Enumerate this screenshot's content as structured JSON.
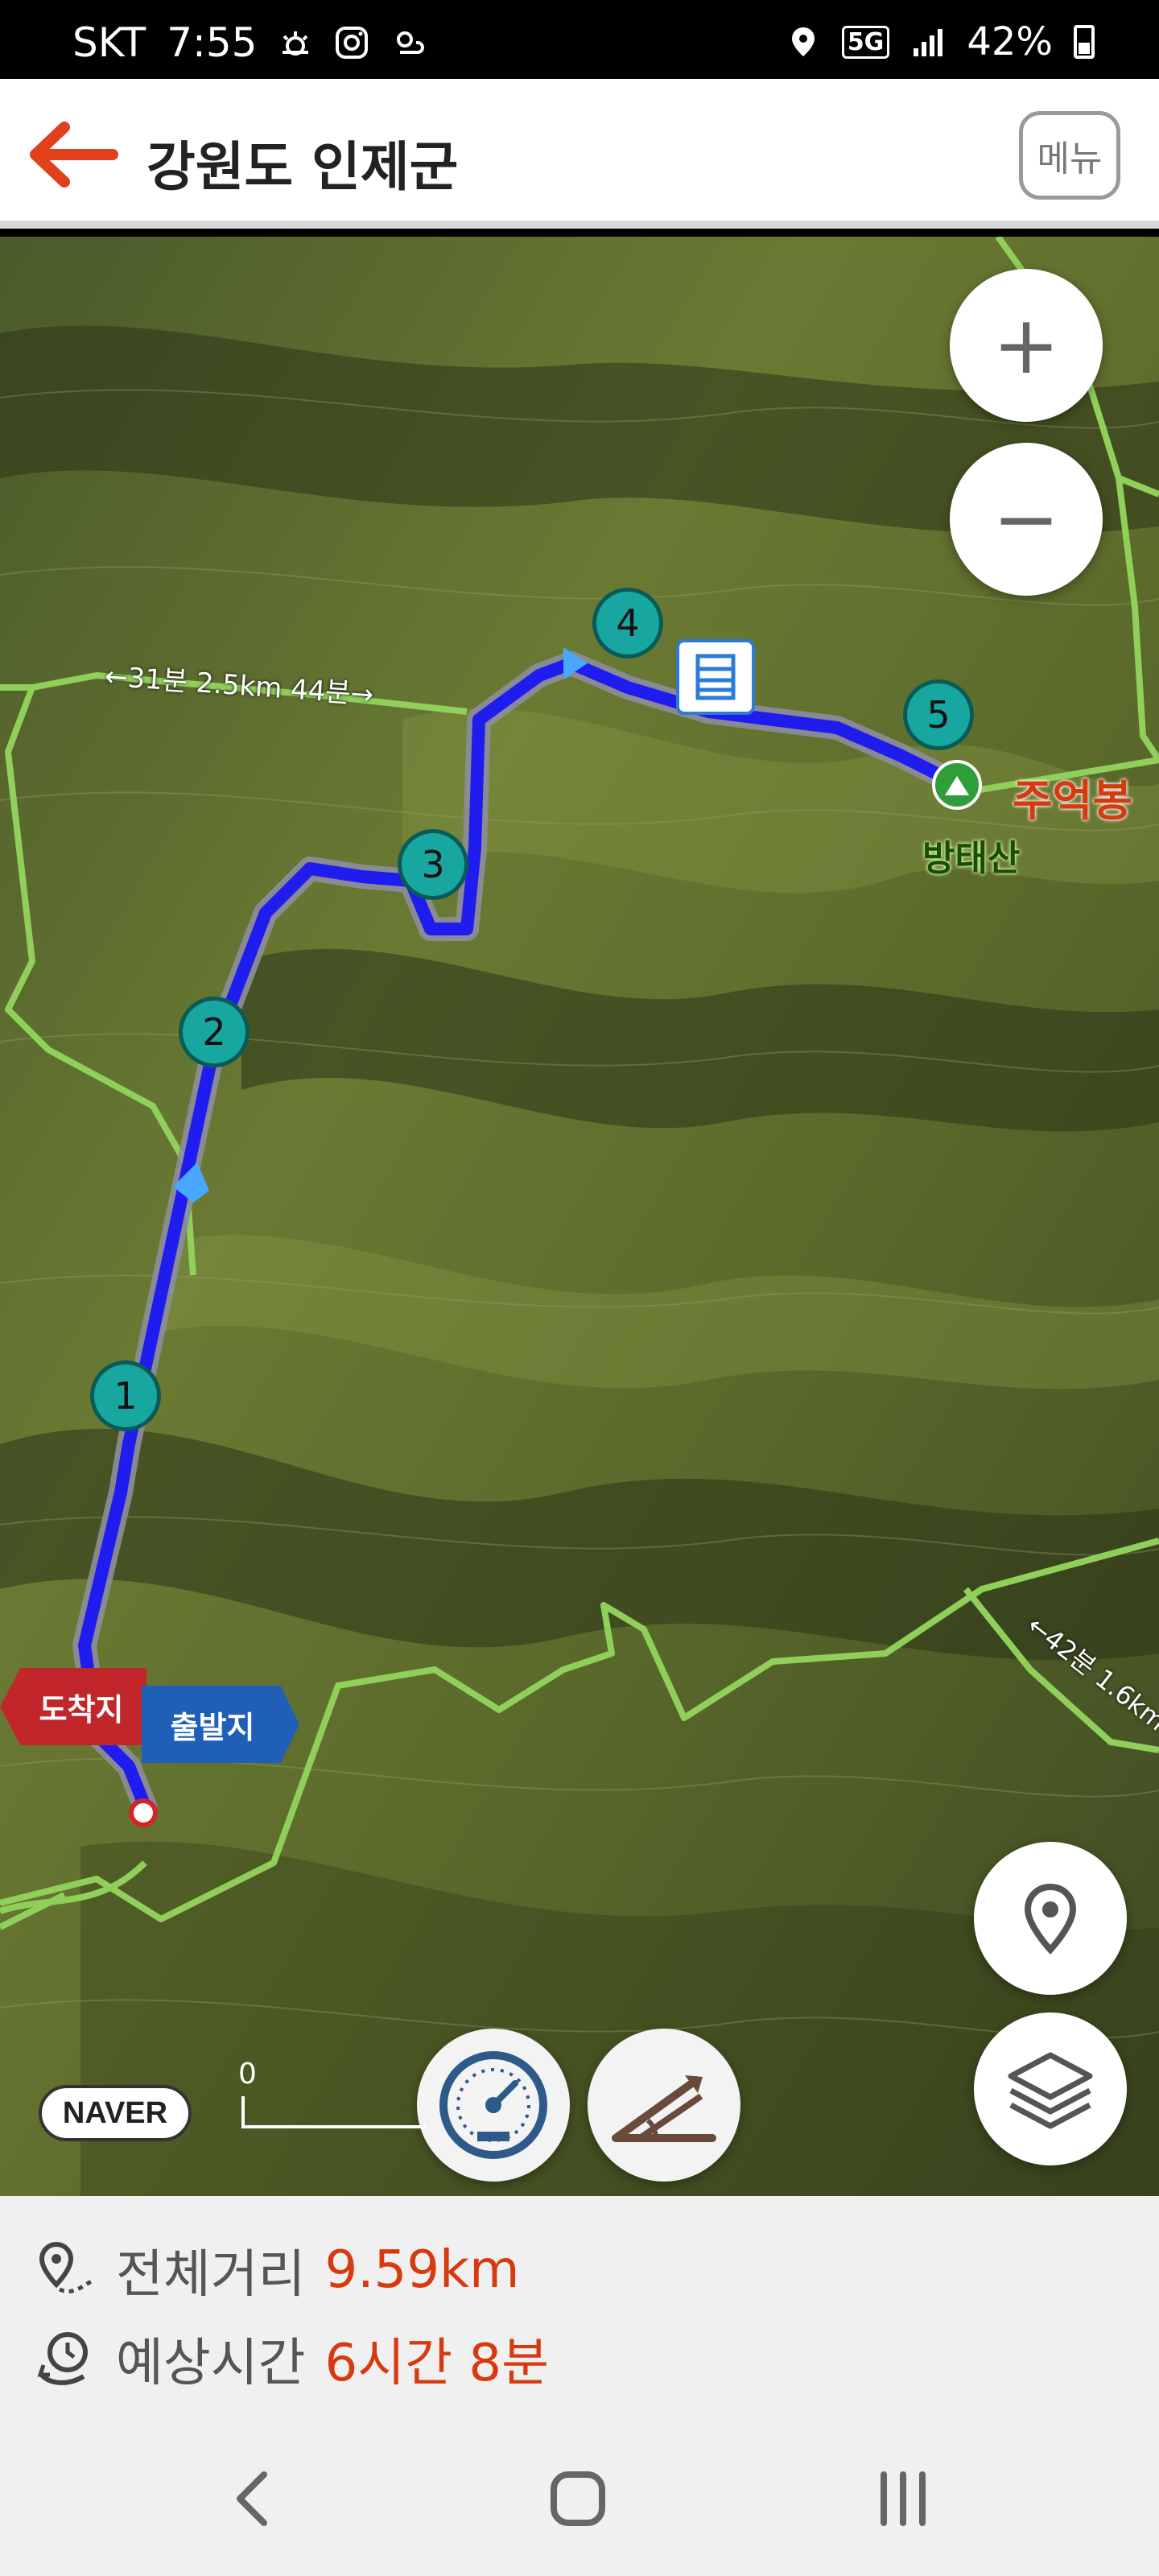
{
  "status_bar": {
    "carrier": "SKT",
    "time": "7:55",
    "network": "5G",
    "battery": "42%",
    "left_icons": [
      "weather-icon",
      "instagram-icon",
      "weather-icon"
    ],
    "right_icons": [
      "location-icon",
      "5g-icon",
      "signal-icon",
      "battery-icon"
    ]
  },
  "header": {
    "title": "강원도 인제군",
    "menu_label": "메뉴",
    "accent": "#e0401c"
  },
  "map": {
    "zoom_in_label": "+",
    "zoom_out_label": "−",
    "waypoints": [
      "1",
      "2",
      "3",
      "4",
      "5"
    ],
    "peak_labels": {
      "jueokbong": "주억봉",
      "bangtaesan": "방태산"
    },
    "flag_arrival": "도착지",
    "flag_departure": "출발지",
    "trail_label_top": "←31분 2.5km 44분→",
    "trail_label_right": "←42분 1.6km",
    "scale_label": "0",
    "provider": "NAVER",
    "route_color": "#1f1cf0"
  },
  "info": {
    "distance_label": "전체거리",
    "distance_value": "9.59km",
    "time_label": "예상시간",
    "time_value": "6시간 8분"
  },
  "nav": {
    "back_icon": "back-icon",
    "home_icon": "home-icon",
    "recents_icon": "recents-icon"
  }
}
